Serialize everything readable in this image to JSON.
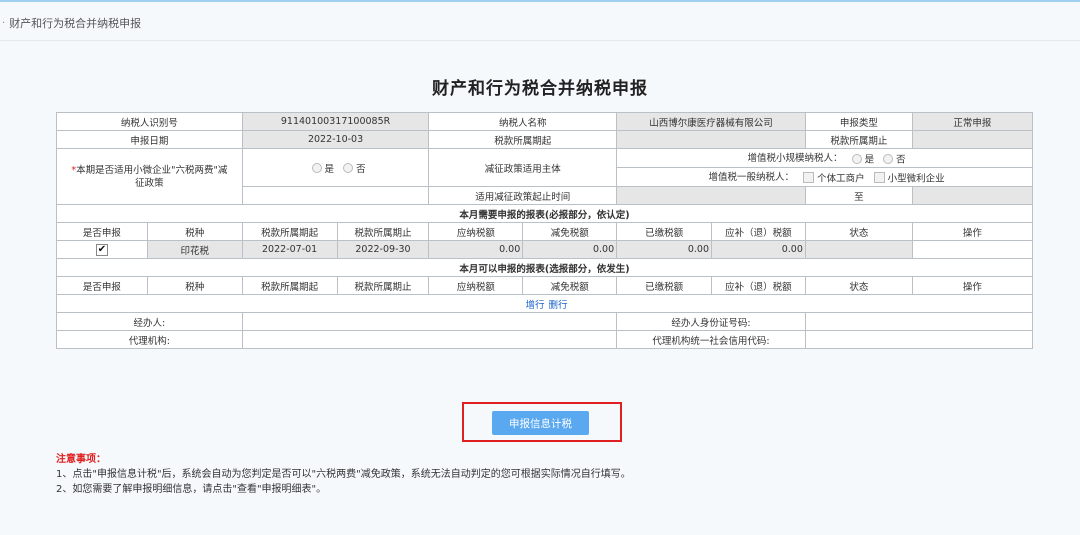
{
  "breadcrumb": {
    "title": "财产和行为税合并纳税申报"
  },
  "page": {
    "title": "财产和行为税合并纳税申报"
  },
  "info": {
    "taxpayer_id_label": "纳税人识别号",
    "taxpayer_id": "91140100317100085R",
    "taxpayer_name_label": "纳税人名称",
    "taxpayer_name": "山西博尔康医疗器械有限公司",
    "decl_type_label": "申报类型",
    "decl_type": "正常申报",
    "decl_date_label": "申报日期",
    "decl_date": "2022-10-03",
    "period_start_label": "税款所属期起",
    "period_start": "",
    "period_end_label": "税款所属期止",
    "period_end": ""
  },
  "policy": {
    "question": "本期是否适用小微企业\"六税两费\"减征政策",
    "opt_yes": "是",
    "opt_no": "否",
    "subject_label": "减征政策适用主体",
    "vat_small_label": "增值税小规模纳税人：",
    "vat_small_yes": "是",
    "vat_small_no": "否",
    "vat_general_label": "增值税一般纳税人：",
    "vat_general_opt1": "个体工商户",
    "vat_general_opt2": "小型微利企业",
    "period_label": "适用减征政策起止时间",
    "to_label": "至"
  },
  "section_required": {
    "title": "本月需要申报的报表(必报部分，依认定)",
    "headers": [
      "是否申报",
      "税种",
      "税款所属期起",
      "税款所属期止",
      "应纳税额",
      "减免税额",
      "已缴税额",
      "应补（退）税额",
      "状态",
      "操作"
    ],
    "rows": [
      {
        "checked": "✔",
        "tax_type": "印花税",
        "start": "2022-07-01",
        "end": "2022-09-30",
        "payable": "0.00",
        "reduction": "0.00",
        "paid": "0.00",
        "due": "0.00",
        "status": "",
        "action": ""
      }
    ]
  },
  "section_optional": {
    "title": "本月可以申报的报表(选报部分，依发生)",
    "headers": [
      "是否申报",
      "税种",
      "税款所属期起",
      "税款所属期止",
      "应纳税额",
      "减免税额",
      "已缴税额",
      "应补（退）税额",
      "状态",
      "操作"
    ],
    "add_row": "增行",
    "delete_row": "删行"
  },
  "agent": {
    "handler_label": "经办人:",
    "handler_id_label": "经办人身份证号码:",
    "agency_label": "代理机构:",
    "agency_code_label": "代理机构统一社会信用代码:"
  },
  "actions": {
    "submit": "申报信息计税"
  },
  "notes": {
    "title": "注意事项：",
    "line1": "1、点击\"申报信息计税\"后，系统会自动为您判定是否可以\"六税两费\"减免政策，系统无法自动判定的您可根据实际情况自行填写。",
    "line2": "2、如您需要了解申报明细信息，请点击\"查看\"申报明细表\"。"
  },
  "colors": {
    "accent": "#5aa9f0",
    "highlight": "#e02020",
    "link": "#1b63c8"
  }
}
